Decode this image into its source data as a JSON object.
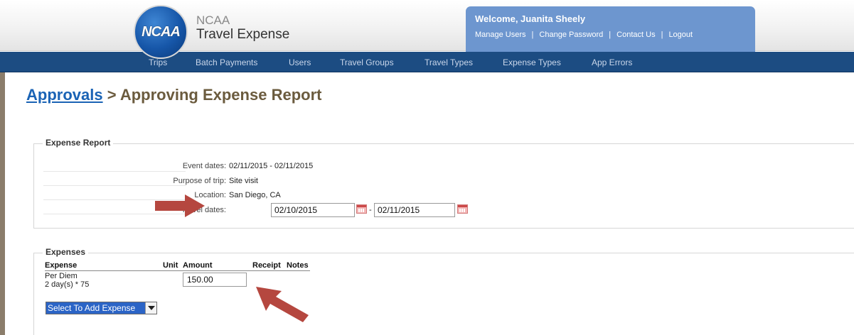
{
  "header": {
    "logo_text": "NCAA",
    "brand_top": "NCAA",
    "brand_bottom": "Travel Expense",
    "welcome": "Welcome, Juanita Sheely",
    "links": [
      "Manage Users",
      "Change Password",
      "Contact Us",
      "Logout"
    ],
    "link_separator": "|"
  },
  "nav": {
    "items": [
      "Trips",
      "Batch Payments",
      "Users",
      "Travel Groups",
      "Travel Types",
      "Expense Types",
      "App Errors"
    ]
  },
  "page": {
    "breadcrumb_link": "Approvals",
    "breadcrumb_separator": " > ",
    "title": "Approving Expense Report"
  },
  "expense_report": {
    "legend": "Expense Report",
    "event_dates_label": "Event dates:",
    "event_dates_value": "02/11/2015 - 02/11/2015",
    "purpose_label": "Purpose of trip:",
    "purpose_value": "Site visit",
    "location_label": "Location:",
    "location_value": "San Diego, CA",
    "travel_dates_label": "Travel dates:",
    "travel_start": "02/10/2015",
    "travel_separator": "-",
    "travel_end": "02/11/2015"
  },
  "expenses": {
    "legend": "Expenses",
    "columns": [
      "Expense",
      "Unit",
      "Amount",
      "Receipt",
      "Notes"
    ],
    "rows": [
      {
        "expense": "Per Diem",
        "detail": "2 day(s) * 75",
        "amount": "150.00"
      }
    ],
    "add_select_label": "Select To Add Expense"
  },
  "colors": {
    "nav_bg": "#1c4c82",
    "welcome_panel": "#6d96cf",
    "title_brown": "#6b5b3e",
    "link_blue": "#1a63b5",
    "arrow_red": "#b5473f"
  }
}
